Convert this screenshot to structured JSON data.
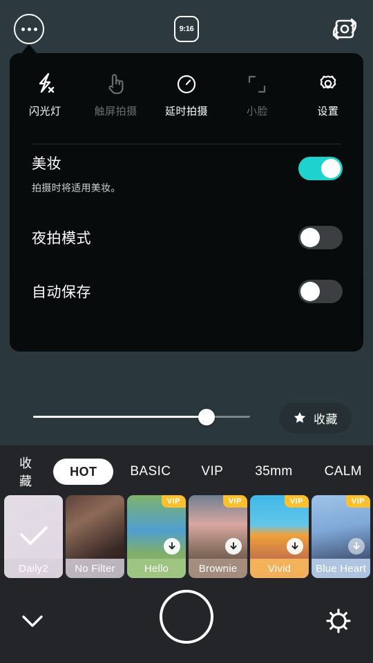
{
  "topbar": {
    "more_icon": "more-horizontal-icon",
    "ratio_label": "9:16",
    "flip_icon": "camera-flip-icon"
  },
  "panel": {
    "tools": [
      {
        "label": "闪光灯",
        "icon": "flash-off-icon",
        "enabled": true
      },
      {
        "label": "触屏拍摄",
        "icon": "touch-shoot-icon",
        "enabled": false
      },
      {
        "label": "延时拍摄",
        "icon": "timer-icon",
        "enabled": true
      },
      {
        "label": "小脸",
        "icon": "small-face-icon",
        "enabled": false
      },
      {
        "label": "设置",
        "icon": "gear-icon",
        "enabled": true
      }
    ],
    "settings": [
      {
        "title": "美妆",
        "subtitle": "拍摄时将适用美妆。",
        "state": "on"
      },
      {
        "title": "夜拍模式",
        "subtitle": "",
        "state": "off"
      },
      {
        "title": "自动保存",
        "subtitle": "",
        "state": "off"
      }
    ]
  },
  "slider": {
    "value_percent": 80,
    "favorites_label": "收藏",
    "star_icon": "star-icon"
  },
  "filters": {
    "categories": [
      {
        "label": "收藏",
        "selected": false
      },
      {
        "label": "HOT",
        "selected": true
      },
      {
        "label": "BASIC",
        "selected": false
      },
      {
        "label": "VIP",
        "selected": false
      },
      {
        "label": "35mm",
        "selected": false
      },
      {
        "label": "CALM",
        "selected": false
      }
    ],
    "items": [
      {
        "name": "Daily2",
        "vip": false,
        "download": false,
        "selected": true
      },
      {
        "name": "No Filter",
        "vip": false,
        "download": false,
        "selected": false
      },
      {
        "name": "Hello",
        "vip": true,
        "download": true,
        "selected": false
      },
      {
        "name": "Brownie",
        "vip": true,
        "download": true,
        "selected": false
      },
      {
        "name": "Vivid",
        "vip": true,
        "download": true,
        "selected": false
      },
      {
        "name": "Blue Heart",
        "vip": true,
        "download": true,
        "selected": false
      }
    ],
    "vip_badge": "VIP"
  },
  "controls": {
    "collapse_icon": "chevron-down-icon",
    "shutter_icon": "shutter-button",
    "settings_icon": "gear-icon"
  },
  "colors": {
    "accent_toggle_on": "#1ed3cd",
    "vip_badge": "#fcc02e",
    "panel_bg": "#080b0c",
    "bottom_bg": "#232528"
  }
}
